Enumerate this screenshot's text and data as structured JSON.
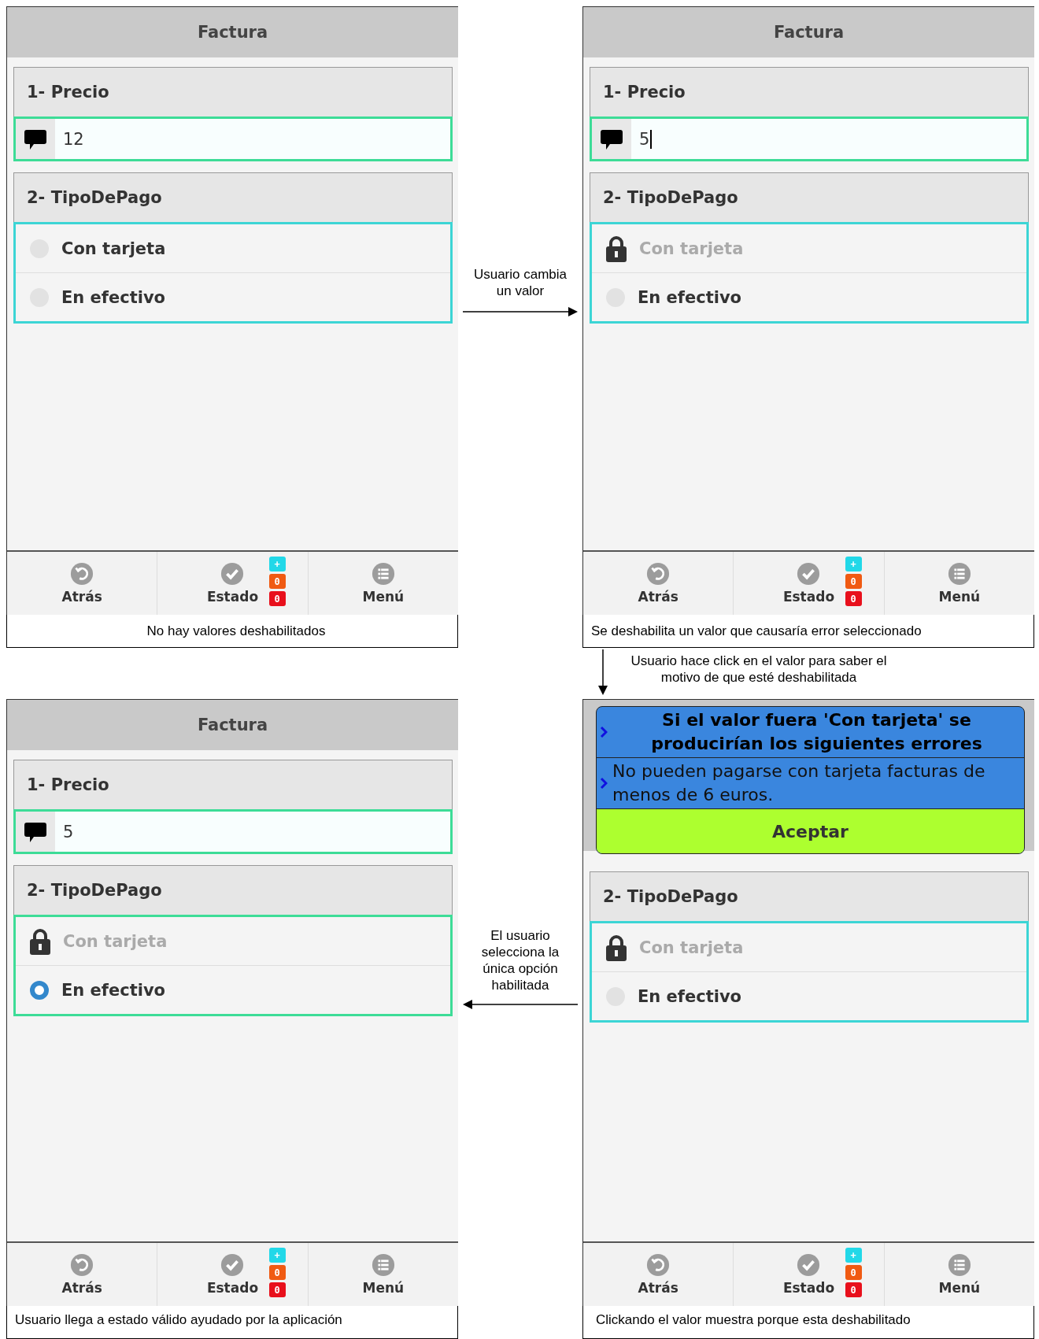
{
  "panels": [
    {
      "title": "Factura",
      "sections": [
        {
          "kind": "text",
          "label": "1- Precio",
          "value": "12",
          "cursor": false,
          "complete": true
        },
        {
          "kind": "radio",
          "label": "2- TipoDePago",
          "complete": false,
          "options": [
            {
              "label": "Con tarjeta",
              "disabled": false,
              "selected": false
            },
            {
              "label": "En efectivo",
              "disabled": false,
              "selected": false
            }
          ]
        }
      ],
      "footer": [
        {
          "kind": "back",
          "label": "Atrás"
        },
        {
          "kind": "status",
          "label": "Estado"
        },
        {
          "kind": "menu",
          "label": "Menú"
        }
      ],
      "badges": [
        {
          "text": "+",
          "color": "#22d8e8"
        },
        {
          "text": "0",
          "color": "#f05a12"
        },
        {
          "text": "0",
          "color": "#e8101c"
        }
      ],
      "caption": "No hay valores deshabilitados"
    },
    {
      "title": "Factura",
      "sections": [
        {
          "kind": "text",
          "label": "1- Precio",
          "value": "5",
          "cursor": true,
          "complete": true
        },
        {
          "kind": "radio",
          "label": "2- TipoDePago",
          "complete": false,
          "options": [
            {
              "label": "Con tarjeta",
              "disabled": true,
              "selected": false
            },
            {
              "label": "En efectivo",
              "disabled": false,
              "selected": false
            }
          ]
        }
      ],
      "footer": [
        {
          "kind": "back",
          "label": "Atrás"
        },
        {
          "kind": "status",
          "label": "Estado"
        },
        {
          "kind": "menu",
          "label": "Menú"
        }
      ],
      "badges": [
        {
          "text": "+",
          "color": "#22d8e8"
        },
        {
          "text": "0",
          "color": "#f05a12"
        },
        {
          "text": "0",
          "color": "#e8101c"
        }
      ],
      "caption": "Se deshabilita un valor que causaría error seleccionado"
    },
    {
      "title": "Factura",
      "sections": [
        {
          "kind": "text",
          "label": "1- Precio",
          "value": "5",
          "cursor": false,
          "complete": true
        },
        {
          "kind": "radio",
          "label": "2- TipoDePago",
          "complete": true,
          "options": [
            {
              "label": "Con tarjeta",
              "disabled": true,
              "selected": false
            },
            {
              "label": "En efectivo",
              "disabled": false,
              "selected": true
            }
          ]
        }
      ],
      "footer": [
        {
          "kind": "back",
          "label": "Atrás"
        },
        {
          "kind": "status",
          "label": "Estado"
        },
        {
          "kind": "menu",
          "label": "Menú"
        }
      ],
      "badges": [
        {
          "text": "+",
          "color": "#22d8e8"
        },
        {
          "text": "0",
          "color": "#f05a12"
        },
        {
          "text": "0",
          "color": "#e8101c"
        }
      ],
      "caption": "Usuario llega a estado válido ayudado por la aplicación"
    },
    {
      "popup": {
        "heading": "Si el valor fuera 'Con tarjeta' se producirían los siguientes errores",
        "message": "No pueden pagarse con tarjeta facturas de menos de 6 euros.",
        "button": "Aceptar"
      },
      "sections": [
        {
          "kind": "radio",
          "label": "2- TipoDePago",
          "complete": false,
          "options": [
            {
              "label": "Con tarjeta",
              "disabled": true,
              "selected": false
            },
            {
              "label": "En efectivo",
              "disabled": false,
              "selected": false
            }
          ]
        }
      ],
      "footer": [
        {
          "kind": "back",
          "label": "Atrás"
        },
        {
          "kind": "status",
          "label": "Estado"
        },
        {
          "kind": "menu",
          "label": "Menú"
        }
      ],
      "badges": [
        {
          "text": "+",
          "color": "#22d8e8"
        },
        {
          "text": "0",
          "color": "#f05a12"
        },
        {
          "text": "0",
          "color": "#e8101c"
        }
      ],
      "caption": "Clickando el valor muestra porque esta deshabilitado"
    }
  ],
  "flows": [
    {
      "kind": "right",
      "label": "Usuario cambia un valor"
    },
    {
      "kind": "down",
      "label": "Usuario hace click en el valor para saber el motivo de que esté deshabilitada"
    },
    {
      "kind": "left",
      "label": "El usuario selecciona la única opción habilitada"
    }
  ]
}
